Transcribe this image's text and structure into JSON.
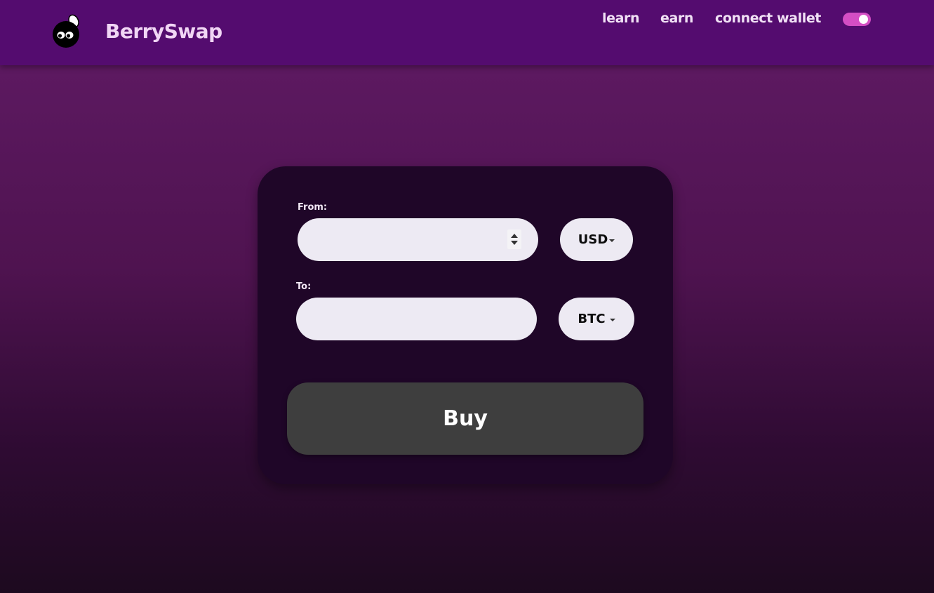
{
  "header": {
    "brand": "BerrySwap",
    "logo_icon": "berry-logo-icon",
    "nav": {
      "learn": "learn",
      "earn": "earn",
      "connect_wallet": "connect wallet"
    },
    "toggle": {
      "state": "on",
      "color": "#d44ec4"
    }
  },
  "swap": {
    "from_label": "From:",
    "from_value": "",
    "from_currency": "USD",
    "to_label": "To:",
    "to_value": "",
    "to_currency": "BTC",
    "buy_label": "Buy"
  },
  "colors": {
    "navbar": "#540c6f",
    "card": "#1f0628",
    "input": "#edeaf3",
    "button": "#3e3e3e"
  }
}
